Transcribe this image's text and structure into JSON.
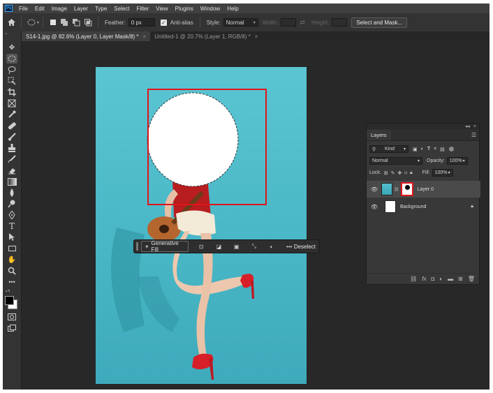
{
  "app": {
    "logo_text": "Ps"
  },
  "menubar": {
    "items": [
      "File",
      "Edit",
      "Image",
      "Layer",
      "Type",
      "Select",
      "Filter",
      "View",
      "Plugins",
      "Window",
      "Help"
    ]
  },
  "options": {
    "feather_label": "Feather:",
    "feather_value": "0 px",
    "antialias_label": "Anti-alias",
    "style_label": "Style:",
    "style_value": "Normal",
    "width_label": "Width:",
    "height_label": "Height:",
    "select_and_mask": "Select and Mask..."
  },
  "tabs": [
    {
      "label": "S14-1.jpg @ 82.6% (Layer 0, Layer Mask/8) *",
      "active": true
    },
    {
      "label": "Untitled-1 @ 20.7% (Layer 1, RGB/8) *",
      "active": false
    }
  ],
  "context_bar": {
    "generative_fill": "Generative Fill",
    "deselect": "Deselect"
  },
  "layers_panel": {
    "tab": "Layers",
    "kind_label": "Kind",
    "blend_mode": "Normal",
    "opacity_label": "Opacity:",
    "opacity_value": "100%",
    "lock_label": "Lock:",
    "fill_label": "Fill:",
    "fill_value": "100%",
    "layers": [
      {
        "name": "Layer 0",
        "selected": true
      },
      {
        "name": "Background",
        "selected": false
      }
    ]
  },
  "colors": {
    "accent_highlight": "#e0141a",
    "photo_background": "#4bb9c8"
  }
}
